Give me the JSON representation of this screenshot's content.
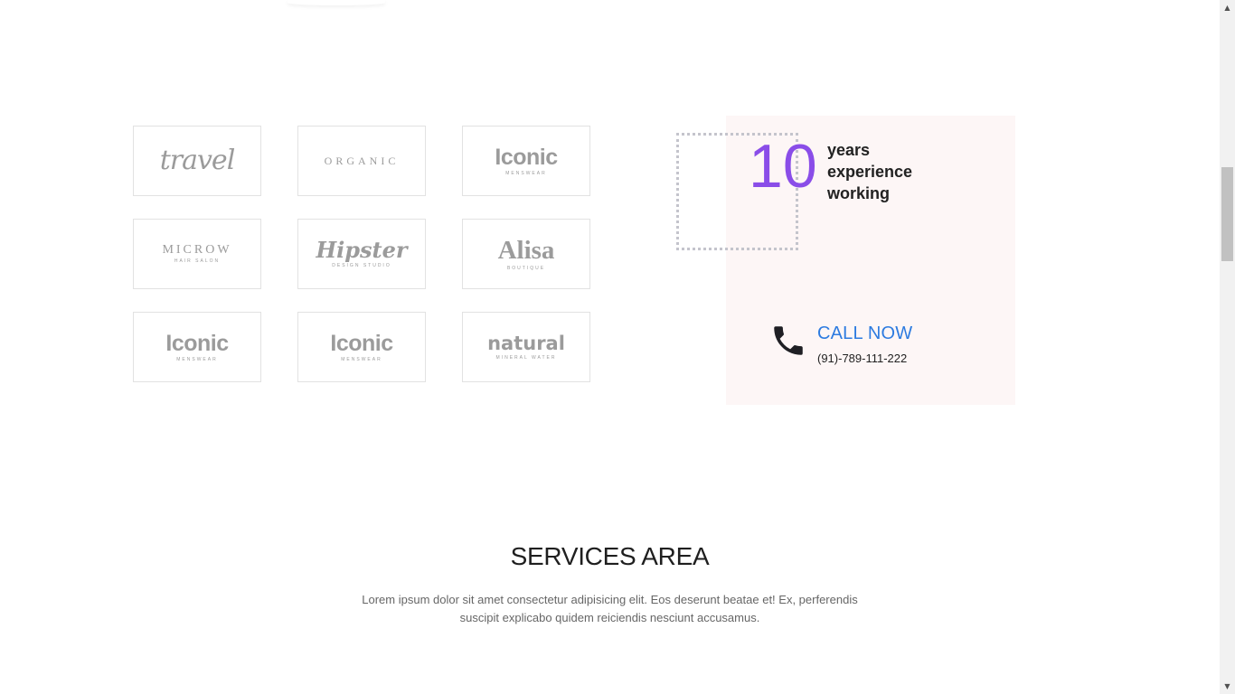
{
  "brand_logos": [
    {
      "main": "travel",
      "sub": "",
      "style": "l-script"
    },
    {
      "main": "ORGANIC",
      "sub": "",
      "style": "l-serif-spaced"
    },
    {
      "main": "Iconic",
      "sub": "MENSWEAR",
      "style": "l-bold"
    },
    {
      "main": "MICROW",
      "sub": "HAIR SALON",
      "style": "l-microw"
    },
    {
      "main": "Hipster",
      "sub": "DESIGN STUDIO",
      "style": "l-hipster"
    },
    {
      "main": "Alisa",
      "sub": "BOUTIQUE",
      "style": "l-serif-bold"
    },
    {
      "main": "Iconic",
      "sub": "MENSWEAR",
      "style": "l-bold"
    },
    {
      "main": "Iconic",
      "sub": "MENSWEAR",
      "style": "l-bold"
    },
    {
      "main": "natural",
      "sub": "MINERAL WATER",
      "style": "l-natural"
    }
  ],
  "experience": {
    "years": "10",
    "text": "years\nexperience\nworking",
    "accent_color": "#8a4de8",
    "panel_color": "#fdf6f6"
  },
  "call": {
    "icon": "phone-icon",
    "label": "CALL NOW",
    "number": "(91)-789-111-222",
    "link_color": "#2d7be0"
  },
  "services": {
    "title": "SERVICES AREA",
    "description": "Lorem ipsum dolor sit amet consectetur adipisicing elit. Eos deserunt beatae et! Ex, perferendis suscipit explicabo quidem reiciendis nesciunt accusamus."
  },
  "scrollbar": {
    "up_icon": "scroll-up-arrow-icon",
    "down_icon": "scroll-down-arrow-icon"
  }
}
